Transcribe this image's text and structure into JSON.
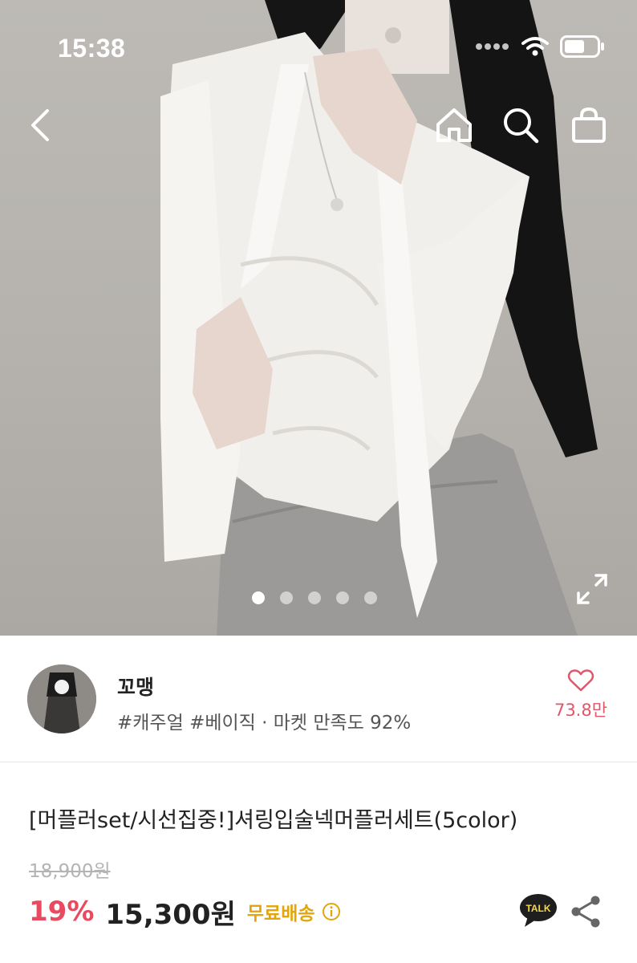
{
  "status_bar": {
    "time": "15:38",
    "icons": [
      "signal-dots-icon",
      "wifi-icon",
      "battery-icon"
    ]
  },
  "nav": {
    "icons": [
      "back-arrow-icon",
      "home-icon",
      "search-icon",
      "shopping-bag-icon"
    ]
  },
  "gallery": {
    "image_count": 5,
    "active_index": 0,
    "expand_icon": "expand-icon"
  },
  "shop": {
    "name": "꼬맹",
    "meta": "#캐주얼 #베이직 · 마켓 만족도 92%",
    "like_count": "73.8만",
    "like_icon": "heart-outline-icon",
    "like_color": "#e0566b"
  },
  "product": {
    "title": "[머플러set/시선집중!]셔링입술넥머플러세트(5color)",
    "original_price": "18,900원",
    "discount": "19%",
    "sale_price": "15,300원",
    "shipping": "무료배송",
    "talk_label": "TALK",
    "colors": {
      "discount": "#e84a5f",
      "shipping": "#e2a50c"
    }
  }
}
